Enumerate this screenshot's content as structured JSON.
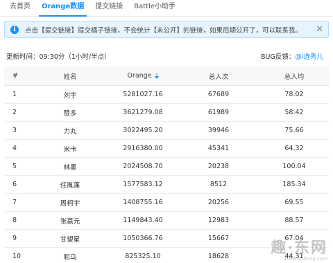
{
  "tabs": [
    {
      "label": "去首页"
    },
    {
      "label": "Orange数据",
      "active": true
    },
    {
      "label": "提交链接"
    },
    {
      "label": "Battle小助手"
    }
  ],
  "notice": {
    "text": "点击【提交链接】提交橘子链接，不会统计【未公开】的链接，如果后期公开了，可以联系我。"
  },
  "meta": {
    "update_time": "更新时间：09:30分（1小时/半点）",
    "feedback_label": "BUG反馈：",
    "feedback_link": "@i选秀儿"
  },
  "table": {
    "columns": [
      "#",
      "姓名",
      "Orange",
      "总人次",
      "总人均"
    ],
    "rows": [
      {
        "rank": "1",
        "name": "刘宇",
        "orange": "5281027.16",
        "count": "67689",
        "avg": "78.02"
      },
      {
        "rank": "2",
        "name": "赞多",
        "orange": "3621279.08",
        "count": "61989",
        "avg": "58.42"
      },
      {
        "rank": "3",
        "name": "力丸",
        "orange": "3022495.20",
        "count": "39946",
        "avg": "75.66"
      },
      {
        "rank": "4",
        "name": "米卡",
        "orange": "2916380.00",
        "count": "45341",
        "avg": "64.32"
      },
      {
        "rank": "5",
        "name": "林墨",
        "orange": "2024508.70",
        "count": "20238",
        "avg": "100.04"
      },
      {
        "rank": "6",
        "name": "任胤蓬",
        "orange": "1577583.12",
        "count": "8512",
        "avg": "185.34"
      },
      {
        "rank": "7",
        "name": "周柯宇",
        "orange": "1408755.16",
        "count": "20256",
        "avg": "69.55"
      },
      {
        "rank": "8",
        "name": "张嘉元",
        "orange": "1149843.40",
        "count": "12983",
        "avg": "88.57"
      },
      {
        "rank": "9",
        "name": "甘望星",
        "orange": "1050366.76",
        "count": "15667",
        "avg": "67.04"
      },
      {
        "rank": "10",
        "name": "和马",
        "orange": "825325.10",
        "count": "18628",
        "avg": "44.31"
      }
    ]
  },
  "watermark": {
    "main": "趣·东网",
    "sub": "www.qudong.com"
  },
  "colors": {
    "accent": "#1890ff",
    "notice_bg": "#e6f4ff",
    "header_bg": "#f7f8fa"
  }
}
